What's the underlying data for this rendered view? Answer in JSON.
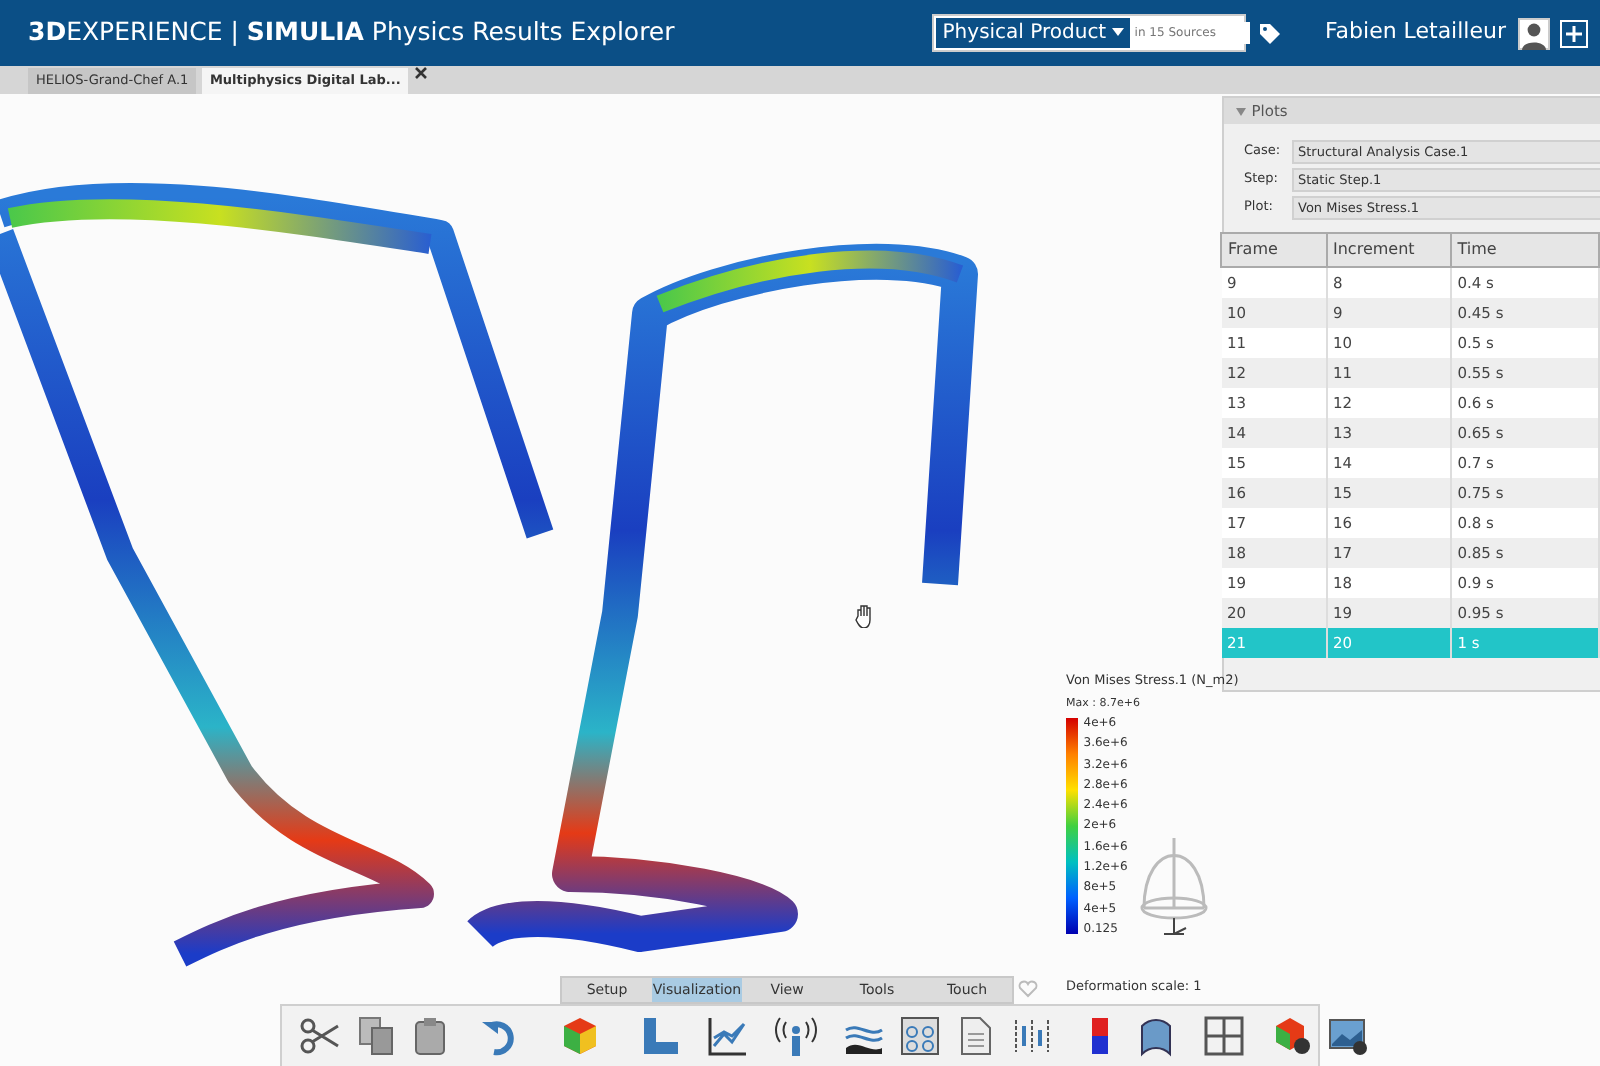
{
  "header": {
    "brand": "**3D**EXPERIENCE | **SIMULIA** Physics Results Explorer",
    "search_scope": "Physical Product",
    "search_placeholder": "in 15 Sources",
    "user": "Fabien Letailleur"
  },
  "doc_tabs": [
    {
      "label": "HELIOS-Grand-Chef A.1",
      "selected": false
    },
    {
      "label": "Multiphysics Digital Lab...",
      "selected": true
    }
  ],
  "plots_panel": {
    "title": "Plots",
    "fields": [
      {
        "label": "Case:",
        "value": "Structural Analysis Case.1"
      },
      {
        "label": "Step:",
        "value": "Static Step.1"
      },
      {
        "label": "Plot:",
        "value": "Von Mises Stress.1"
      }
    ],
    "columns": [
      "Frame",
      "Increment",
      "Time"
    ],
    "rows": [
      {
        "cells": [
          "9",
          "8",
          "0.4 s"
        ],
        "selected": false
      },
      {
        "cells": [
          "10",
          "9",
          "0.45 s"
        ],
        "selected": false
      },
      {
        "cells": [
          "11",
          "10",
          "0.5 s"
        ],
        "selected": false
      },
      {
        "cells": [
          "12",
          "11",
          "0.55 s"
        ],
        "selected": false
      },
      {
        "cells": [
          "13",
          "12",
          "0.6 s"
        ],
        "selected": false
      },
      {
        "cells": [
          "14",
          "13",
          "0.65 s"
        ],
        "selected": false
      },
      {
        "cells": [
          "15",
          "14",
          "0.7 s"
        ],
        "selected": false
      },
      {
        "cells": [
          "16",
          "15",
          "0.75 s"
        ],
        "selected": false
      },
      {
        "cells": [
          "17",
          "16",
          "0.8 s"
        ],
        "selected": false
      },
      {
        "cells": [
          "18",
          "17",
          "0.85 s"
        ],
        "selected": false
      },
      {
        "cells": [
          "19",
          "18",
          "0.9 s"
        ],
        "selected": false
      },
      {
        "cells": [
          "20",
          "19",
          "0.95 s"
        ],
        "selected": false
      },
      {
        "cells": [
          "21",
          "20",
          "1 s"
        ],
        "selected": true
      }
    ]
  },
  "legend": {
    "title": "Von Mises Stress.1 (N_m2)",
    "max": "Max : 8.7e+6",
    "ticks": [
      "4e+6",
      "3.6e+6",
      "3.2e+6",
      "2.8e+6",
      "2.4e+6",
      "2e+6",
      "1.6e+6",
      "1.2e+6",
      "8e+5",
      "4e+5",
      "0.125"
    ]
  },
  "deformation_scale": "Deformation scale: 1",
  "toolbar_tabs": [
    {
      "label": "Setup",
      "selected": false
    },
    {
      "label": "Visualization",
      "selected": true
    },
    {
      "label": "View",
      "selected": false
    },
    {
      "label": "Tools",
      "selected": false
    },
    {
      "label": "Touch",
      "selected": false
    }
  ]
}
